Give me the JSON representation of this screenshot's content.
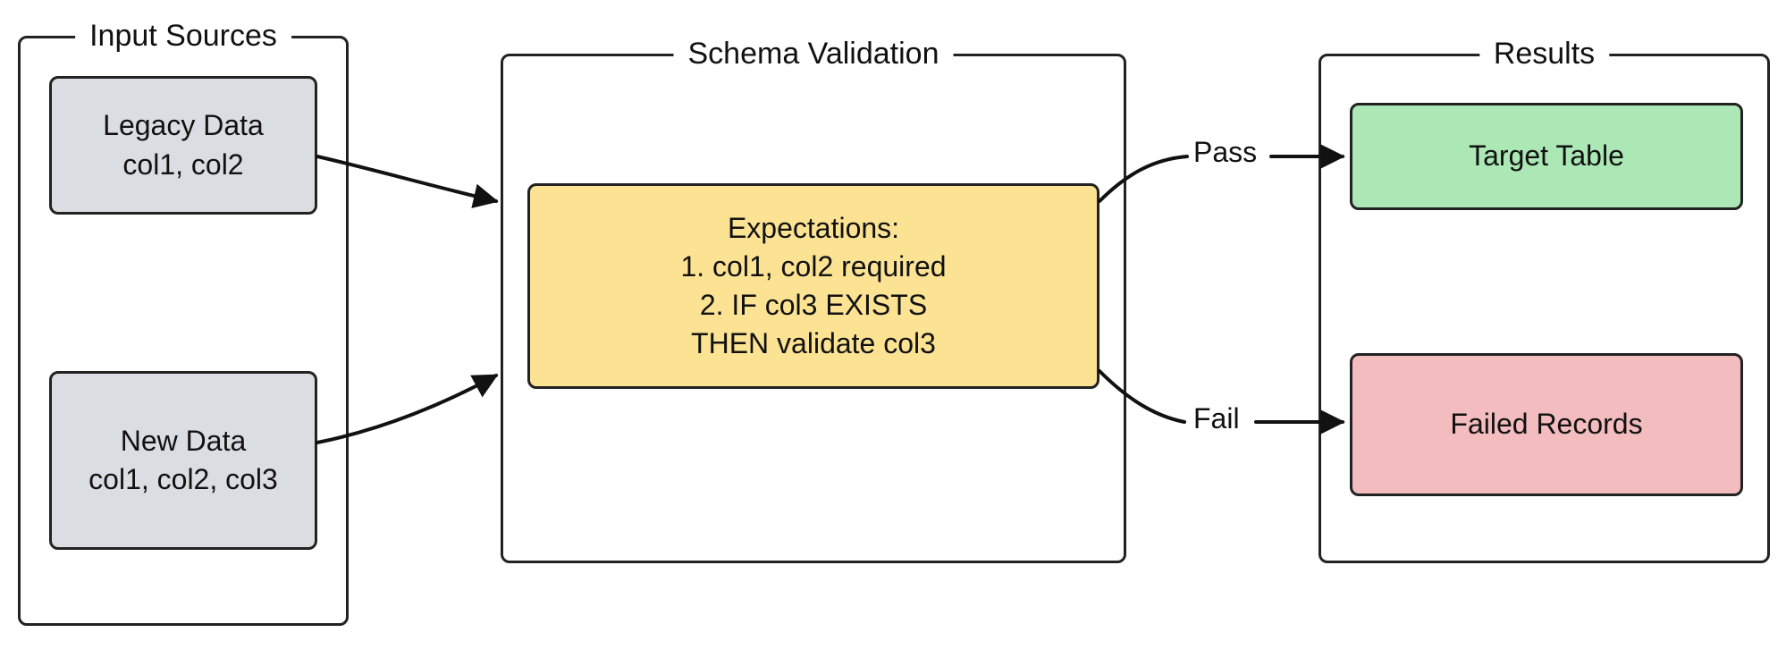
{
  "panels": {
    "input": {
      "title": "Input Sources"
    },
    "schema": {
      "title": "Schema Validation"
    },
    "results": {
      "title": "Results"
    }
  },
  "boxes": {
    "legacy": {
      "line1": "Legacy Data",
      "line2": "col1, col2"
    },
    "new": {
      "line1": "New Data",
      "line2": "col1, col2, col3"
    },
    "expect": {
      "line1": "Expectations:",
      "line2": "1. col1, col2 required",
      "line3": "2. IF col3 EXISTS",
      "line4": "THEN validate col3"
    },
    "target": {
      "label": "Target Table"
    },
    "failed": {
      "label": "Failed Records"
    }
  },
  "edges": {
    "pass": "Pass",
    "fail": "Fail"
  }
}
